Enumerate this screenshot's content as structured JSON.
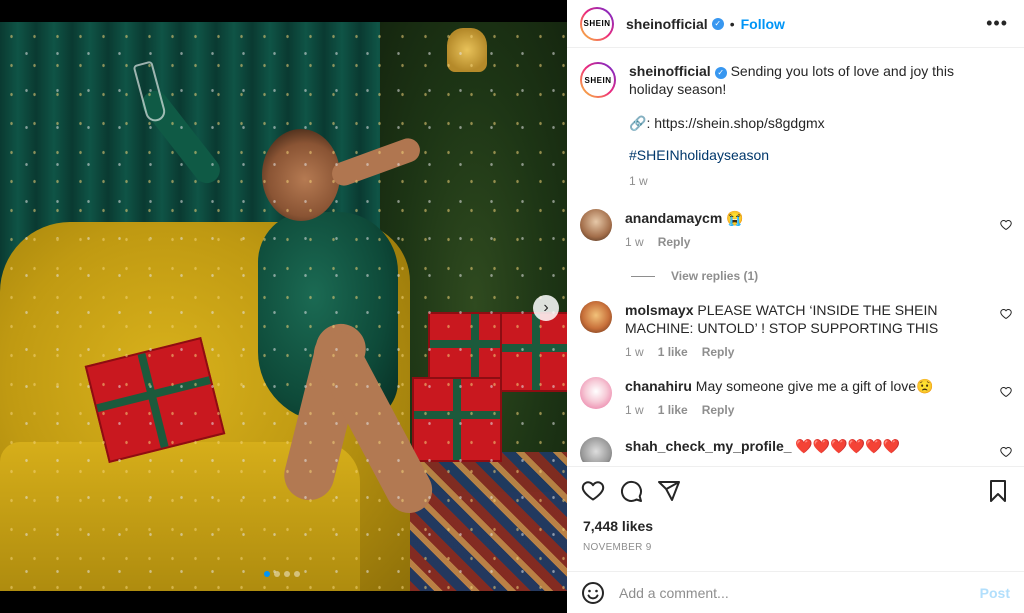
{
  "post": {
    "author": "sheinofficial",
    "avatar_text": "SHEIN",
    "follow_label": "Follow",
    "separator": "•",
    "more_label": "•••",
    "caption": "Sending you lots of love and joy this holiday season!",
    "link_icon": "🔗",
    "link_text": ": https://shein.shop/s8gdgmx",
    "hashtag": "#SHEINholidayseason",
    "caption_time": "1 w",
    "likes": "7,448 likes",
    "date": "NOVEMBER 9",
    "media": {
      "next_icon": "›",
      "slide_count": 4,
      "active_slide": 0
    }
  },
  "comments": [
    {
      "user": "anandamaycm",
      "text": "😭",
      "time": "1 w",
      "likes": "",
      "reply_label": "Reply",
      "view_replies": "View replies (1)"
    },
    {
      "user": "molsmayx",
      "text": "PLEASE WATCH ‘INSIDE THE SHEIN MACHINE: UNTOLD’ ! STOP SUPPORTING THIS",
      "time": "1 w",
      "likes": "1 like",
      "reply_label": "Reply"
    },
    {
      "user": "chanahiru",
      "text": "May someone give me a gift of love😟",
      "time": "1 w",
      "likes": "1 like",
      "reply_label": "Reply"
    },
    {
      "user": "shah_check_my_profile_",
      "text": "❤️❤️❤️❤️❤️❤️",
      "time": "",
      "likes": "",
      "reply_label": ""
    }
  ],
  "composer": {
    "placeholder": "Add a comment...",
    "post_label": "Post"
  },
  "icons": {
    "verified": "verified-badge-icon",
    "like": "heart-icon",
    "comment": "comment-icon",
    "share": "share-icon",
    "save": "bookmark-icon",
    "emoji": "emoji-icon",
    "comment_like": "heart-icon"
  },
  "colors": {
    "accent": "#0095f6",
    "verified": "#3897f0",
    "hashtag": "#00376b",
    "muted": "#8e8e8e",
    "post_disabled": "#b2dffc"
  }
}
